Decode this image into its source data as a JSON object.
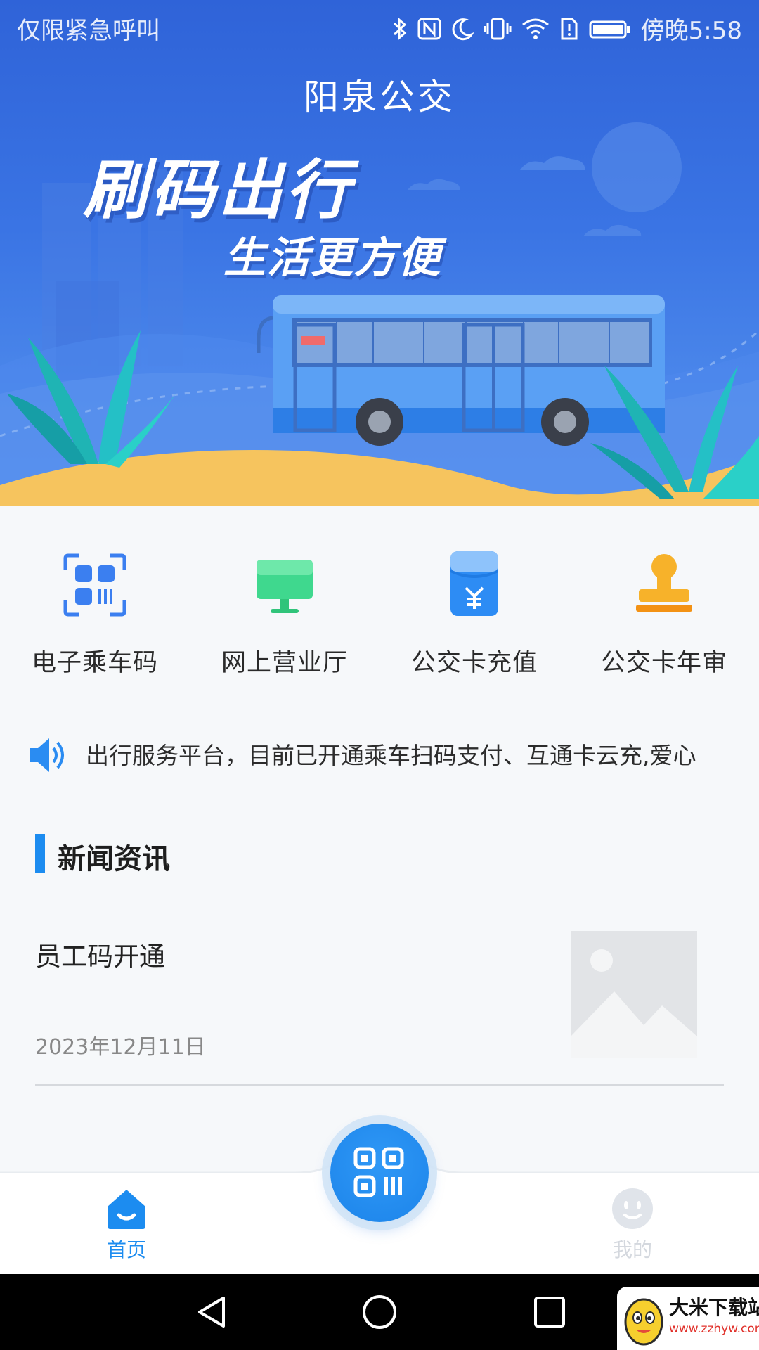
{
  "status_bar": {
    "emergency_text": "仅限紧急呼叫",
    "time": "傍晚5:58",
    "icons": [
      "bluetooth-icon",
      "nfc-icon",
      "moon-icon",
      "vibrate-icon",
      "wifi-icon",
      "sim-alert-icon",
      "battery-icon"
    ]
  },
  "header": {
    "title": "阳泉公交"
  },
  "banner": {
    "slogan_main": "刷码出行",
    "slogan_sub": "生活更方便"
  },
  "quick_menu": [
    {
      "label": "电子乘车码",
      "icon": "qr-code-icon"
    },
    {
      "label": "网上营业厅",
      "icon": "monitor-icon"
    },
    {
      "label": "公交卡充值",
      "icon": "recharge-card-icon"
    },
    {
      "label": "公交卡年审",
      "icon": "stamp-icon"
    }
  ],
  "notice": {
    "icon": "speaker-icon",
    "text": "出行服务平台，目前已开通乘车扫码支付、互通卡云充,爱心"
  },
  "news": {
    "section_title": "新闻资讯",
    "items": [
      {
        "title": "员工码开通",
        "date": "2023年12月11日",
        "thumb": "image-placeholder-icon"
      }
    ]
  },
  "tabbar": {
    "home_label": "首页",
    "mine_label": "我的",
    "center_button": "qr-scan-icon"
  },
  "colors": {
    "primary": "#1c8cf0",
    "hero_blue": "#3a74e4",
    "sand": "#f6c45e",
    "inactive": "#d4d8de"
  },
  "watermark": {
    "name": "大米下载站",
    "url": "www.zzhyw.com"
  }
}
